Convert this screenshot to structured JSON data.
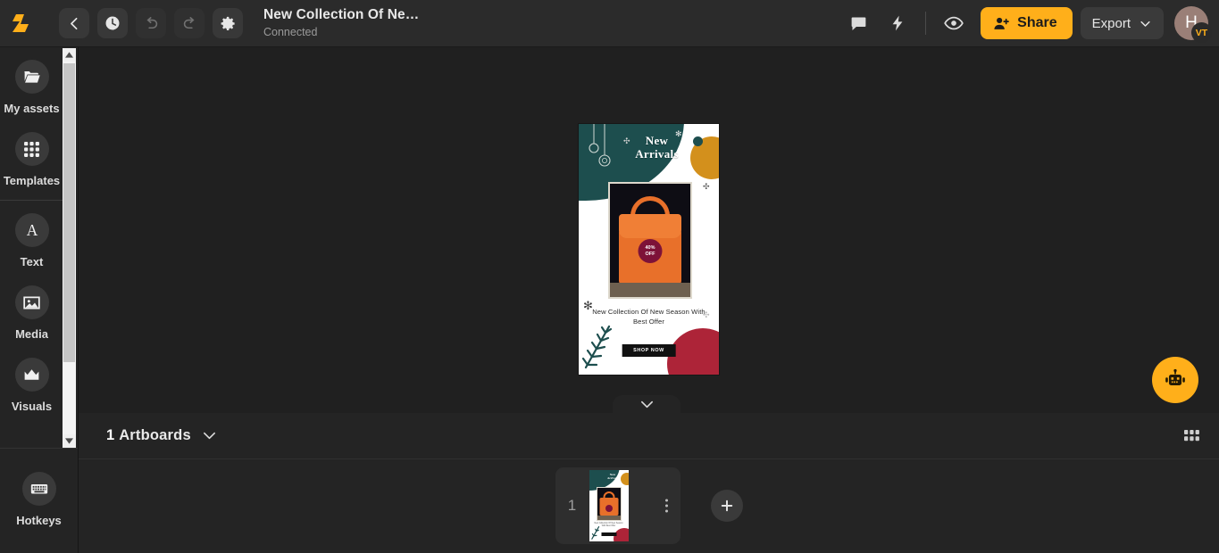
{
  "app": {
    "logo_name": "app-logo",
    "accent_color": "#FFAF1A",
    "topbar_bg": "#2b2b2b",
    "canvas_bg": "#202020"
  },
  "topbar": {
    "back_label": "Back",
    "history_label": "History",
    "undo_label": "Undo",
    "redo_label": "Redo",
    "settings_label": "Settings",
    "document_title": "New Collection Of Ne…",
    "document_status": "Connected",
    "comments_label": "Comments",
    "actions_label": "Quick actions",
    "preview_label": "Preview",
    "share_label": "Share",
    "export_label": "Export",
    "avatar_initial": "H",
    "avatar_badge": "VT"
  },
  "sidebar": {
    "items": [
      {
        "label": "My assets",
        "icon": "folder-icon"
      },
      {
        "label": "Templates",
        "icon": "grid-icon"
      },
      {
        "label": "Text",
        "icon": "text-a-icon"
      },
      {
        "label": "Media",
        "icon": "image-icon"
      },
      {
        "label": "Visuals",
        "icon": "crown-icon"
      }
    ],
    "bottom": {
      "label": "Hotkeys",
      "icon": "keyboard-icon"
    }
  },
  "canvas": {
    "ai_assistant_label": "AI Assistant",
    "collapse_label": "Collapse panel",
    "artboard": {
      "heading": "New\nArrivals",
      "heading_line1": "New",
      "heading_line2": "Arrivals",
      "badge_line1": "40%",
      "badge_line2": "OFF",
      "description": "New Collection Of New Season With Best Offer",
      "cta": "SHOP NOW",
      "colors": {
        "teal": "#1d4e4e",
        "orange": "#d3901c",
        "red": "#ad2438",
        "bag": "#e8702a",
        "badge": "#7d1238"
      }
    }
  },
  "artboards_panel": {
    "count": "1",
    "count_label": "Artboards",
    "expand_label": "Show artboards",
    "grid_view_label": "Grid view",
    "items": [
      {
        "number": "1",
        "menu_label": "Artboard options"
      }
    ],
    "add_label": "Add artboard"
  }
}
